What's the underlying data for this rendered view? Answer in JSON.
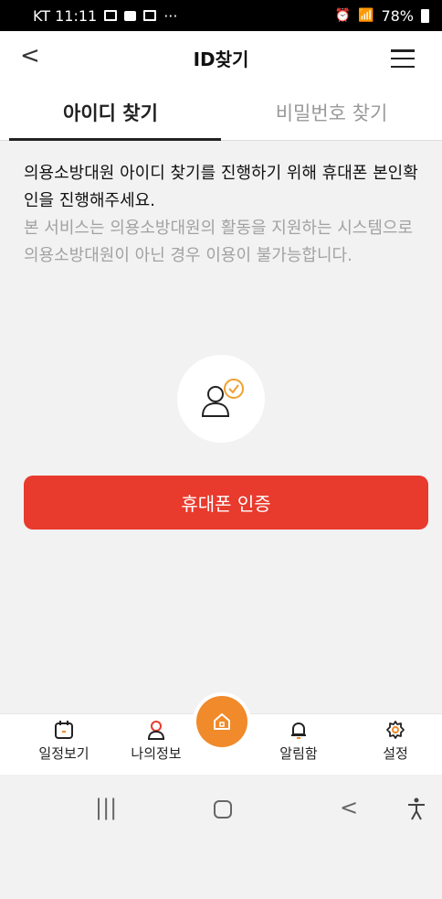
{
  "status_bar": {
    "carrier_time": "KT 11:11",
    "dots": "···",
    "signal_text": "78%"
  },
  "header": {
    "back_glyph": "<",
    "title": "ID찾기",
    "menu_icon": "hamburger-icon"
  },
  "tabs": [
    {
      "label": "아이디 찾기",
      "active": true
    },
    {
      "label": "비밀번호 찾기",
      "active": false
    }
  ],
  "intro": {
    "main": "의용소방대원 아이디 찾기를 진행하기 위해 휴대폰 본인확인을 진행해주세요.",
    "sub": "본 서비스는 의용소방대원의 활동을 지원하는 시스템으로 의용소방대원이 아닌 경우 이용이 불가능합니다."
  },
  "verify_button": {
    "label": "휴대폰 인증"
  },
  "bottom_nav": [
    {
      "label": "일정보기",
      "icon": "calendar-icon"
    },
    {
      "label": "나의정보",
      "icon": "person-icon"
    },
    {
      "label": "",
      "icon": "home-icon"
    },
    {
      "label": "알림함",
      "icon": "bell-icon"
    },
    {
      "label": "설정",
      "icon": "gear-icon"
    }
  ],
  "colors": {
    "accent": "#e83a2d",
    "home": "#f08a2a",
    "icon_orange": "#f0a030"
  }
}
